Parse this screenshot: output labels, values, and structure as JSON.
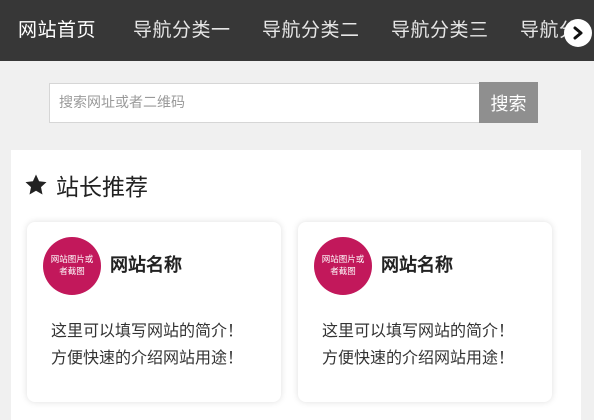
{
  "nav": {
    "items": [
      {
        "label": "网站首页"
      },
      {
        "label": "导航分类一"
      },
      {
        "label": "导航分类二"
      },
      {
        "label": "导航分类三"
      },
      {
        "label": "导航分"
      }
    ],
    "next_icon": "chevron-right-icon"
  },
  "search": {
    "placeholder": "搜索网址或者二维码",
    "value": "",
    "button_label": "搜索"
  },
  "section": {
    "icon": "star-icon",
    "title": "站长推荐"
  },
  "cards": [
    {
      "thumb_label": "网站图片或者截图",
      "name": "网站名称",
      "desc_line1": "这里可以填写网站的简介！",
      "desc_line2": "方便快速的介绍网站用途！"
    },
    {
      "thumb_label": "网站图片或者截图",
      "name": "网站名称",
      "desc_line1": "这里可以填写网站的简介！",
      "desc_line2": "方便快速的介绍网站用途！"
    }
  ],
  "colors": {
    "nav_bg": "#373737",
    "thumb_bg": "#c2185b",
    "search_button_bg": "#8f8f8f"
  }
}
